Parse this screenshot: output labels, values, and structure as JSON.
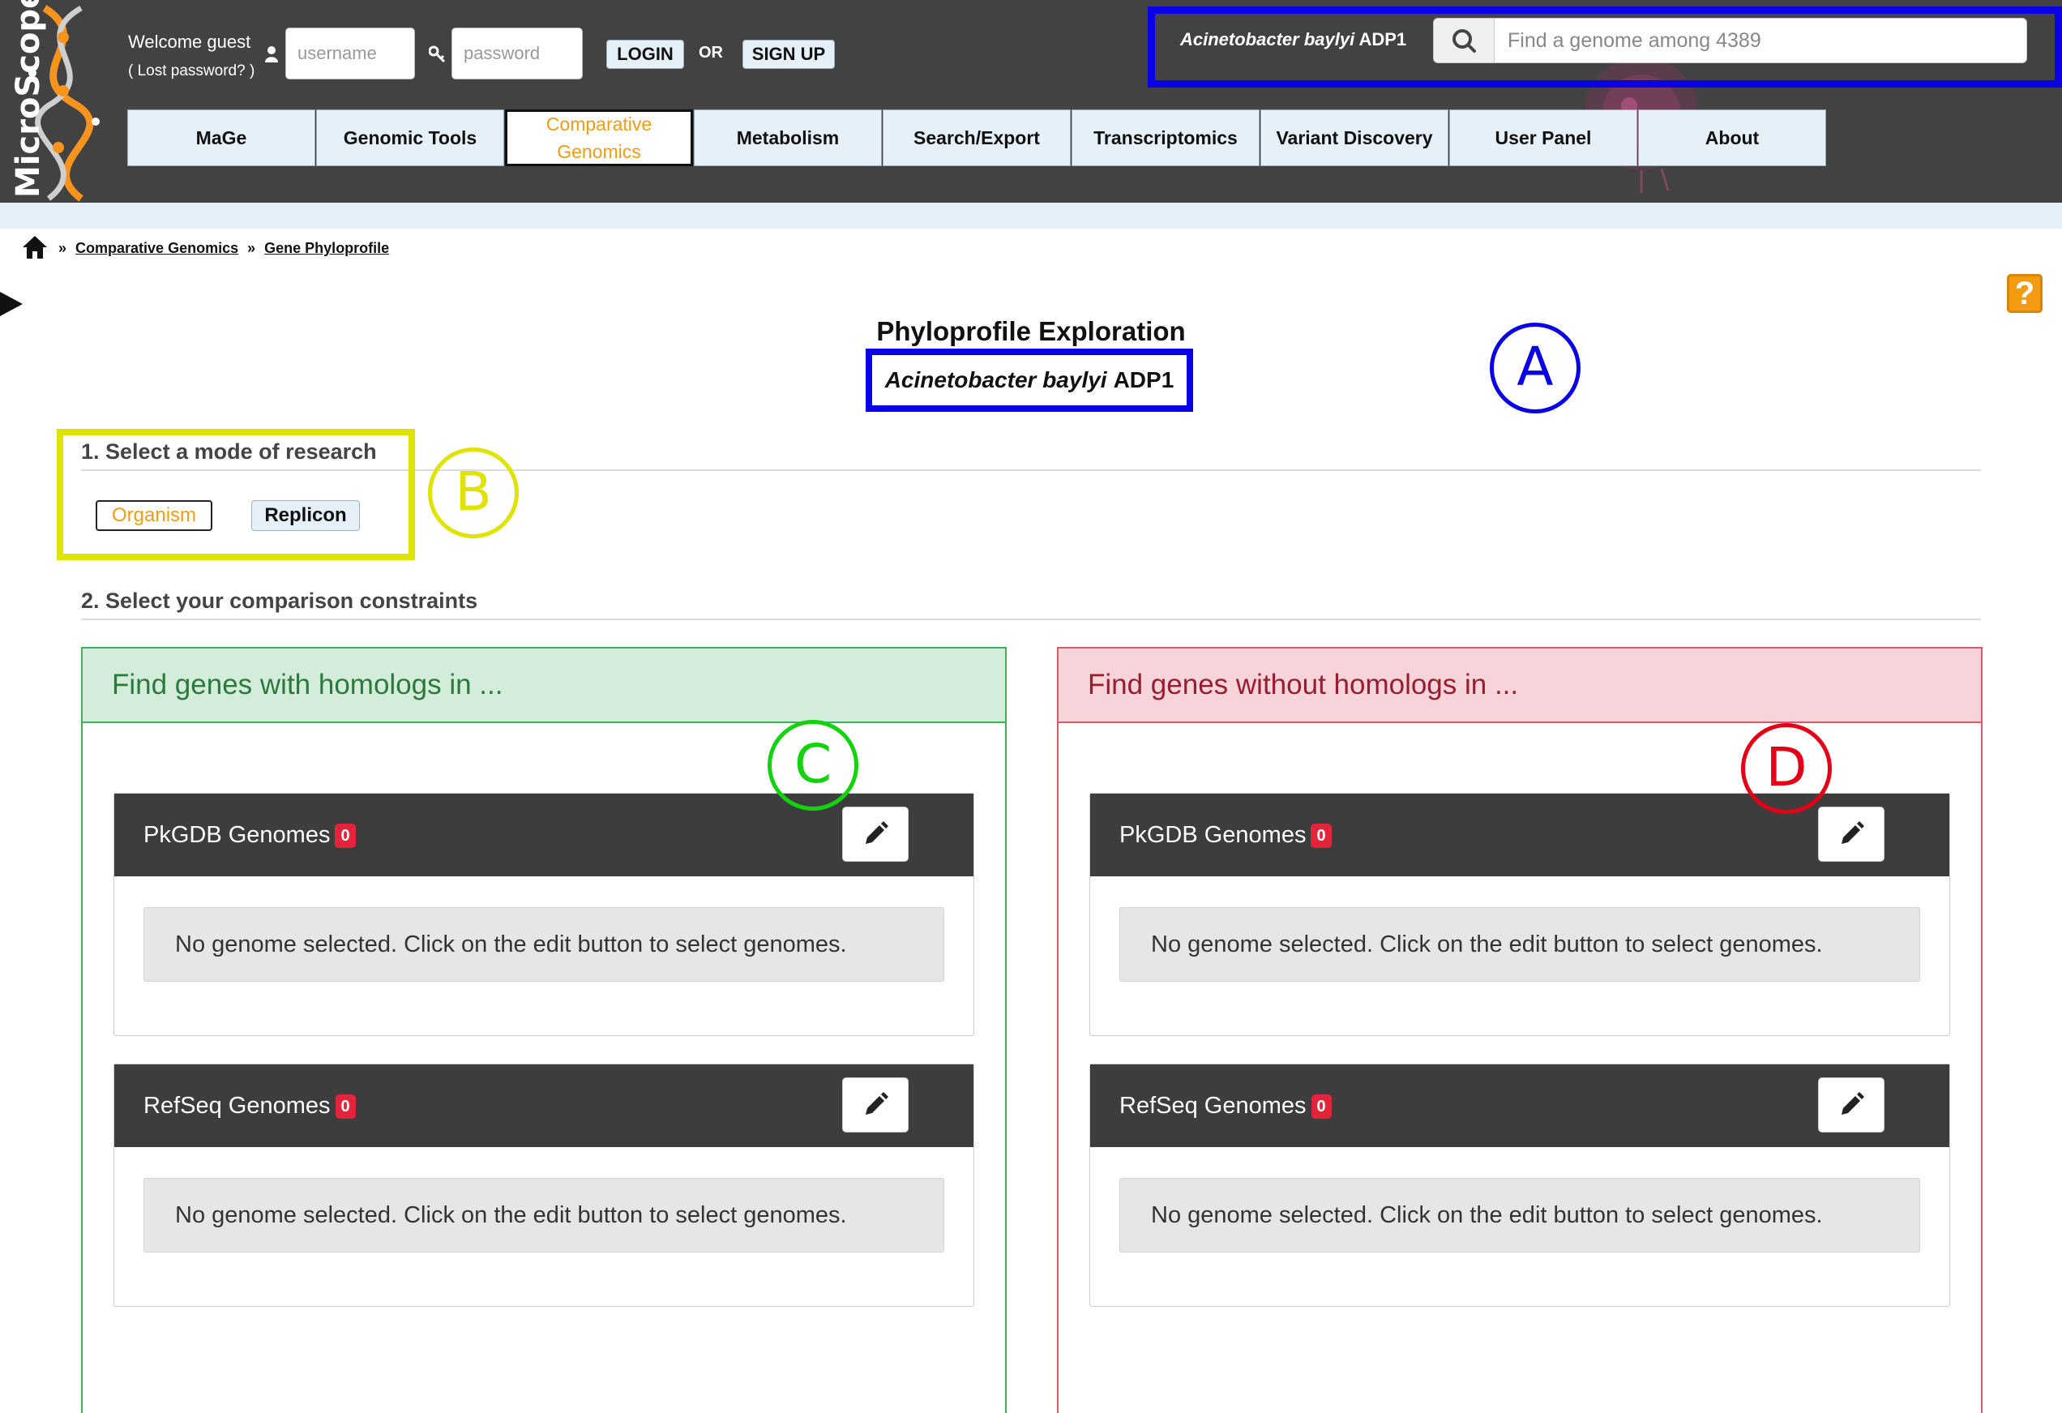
{
  "header": {
    "logo_text": "MicroScope",
    "welcome": "Welcome guest",
    "lost_password": "( Lost password? )",
    "username_placeholder": "username",
    "password_placeholder": "password",
    "login_label": "LOGIN",
    "or_label": "OR",
    "signup_label": "SIGN UP",
    "organism_italic": "Acinetobacter baylyi",
    "organism_strain": "ADP1",
    "search_placeholder": "Find a genome among 4389"
  },
  "nav": {
    "items": [
      {
        "label": "MaGe"
      },
      {
        "label": "Genomic Tools"
      },
      {
        "label": "Comparative Genomics",
        "active": true
      },
      {
        "label": "Metabolism"
      },
      {
        "label": "Search/Export"
      },
      {
        "label": "Transcriptomics"
      },
      {
        "label": "Variant Discovery"
      },
      {
        "label": "User Panel"
      },
      {
        "label": "About"
      }
    ]
  },
  "breadcrumb": {
    "separator": "»",
    "items": [
      "Comparative Genomics",
      "Gene Phyloprofile"
    ]
  },
  "help": {
    "label": "?"
  },
  "page": {
    "title": "Phyloprofile Exploration",
    "organism_italic": "Acinetobacter baylyi",
    "organism_strain": "ADP1"
  },
  "annotations": {
    "a": "A",
    "b": "B",
    "c": "C",
    "d": "D"
  },
  "step1": {
    "heading": "1. Select a mode of research",
    "organism_label": "Organism",
    "replicon_label": "Replicon",
    "selected": "Organism"
  },
  "step2": {
    "heading": "2. Select your comparison constraints"
  },
  "panels": {
    "with": {
      "title": "Find genes with homologs in ...",
      "pkgdb": {
        "label": "PkGDB Genomes",
        "count": "0",
        "empty_msg": "No genome selected. Click on the edit button to select genomes."
      },
      "refseq": {
        "label": "RefSeq Genomes",
        "count": "0",
        "empty_msg": "No genome selected. Click on the edit button to select genomes."
      }
    },
    "without": {
      "title": "Find genes without homologs in ...",
      "pkgdb": {
        "label": "PkGDB Genomes",
        "count": "0",
        "empty_msg": "No genome selected. Click on the edit button to select genomes."
      },
      "refseq": {
        "label": "RefSeq Genomes",
        "count": "0",
        "empty_msg": "No genome selected. Click on the edit button to select genomes."
      }
    }
  },
  "colors": {
    "header_bg": "#424242",
    "nav_bg": "#e6f0f8",
    "accent_orange": "#f39c12",
    "annotation_blue": "#0a00e6",
    "annotation_yellow": "#dfe300",
    "annotation_green": "#14d20f",
    "annotation_red": "#e30016",
    "badge_red": "#e3243a"
  },
  "icons": [
    "logo",
    "user-icon",
    "key-icon",
    "search-icon",
    "home-icon",
    "sidebar-arrow-icon",
    "help-icon",
    "pencil-icon"
  ]
}
